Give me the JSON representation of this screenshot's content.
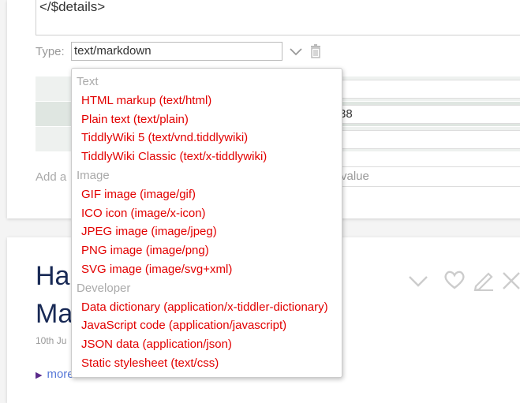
{
  "editor": {
    "text": "</$details>"
  },
  "type_field": {
    "label": "Type:",
    "value": "text/markdown"
  },
  "fields": {
    "row2_value_fragment": "38",
    "add_label": "Add a",
    "value_placeholder": "value"
  },
  "next_tiddler": {
    "title_line1": "Ha",
    "title_line2": "Ma",
    "date_fragment": "10th Ju",
    "more_label": "more"
  },
  "dropdown": {
    "groups": [
      {
        "label": "Text",
        "options": [
          "HTML markup (text/html)",
          "Plain text (text/plain)",
          "TiddlyWiki 5 (text/vnd.tiddlywiki)",
          "TiddlyWiki Classic (text/x-tiddlywiki)"
        ]
      },
      {
        "label": "Image",
        "options": [
          "GIF image (image/gif)",
          "ICO icon (image/x-icon)",
          "JPEG image (image/jpeg)",
          "PNG image (image/png)",
          "SVG image (image/svg+xml)"
        ]
      },
      {
        "label": "Developer",
        "options": [
          "Data dictionary (application/x-tiddler-dictionary)",
          "JavaScript code (application/javascript)",
          "JSON data (application/json)",
          "Static stylesheet (text/css)"
        ]
      }
    ]
  },
  "colors": {
    "option_text": "#e20000",
    "group_label": "#aaaaaa",
    "title": "#182955"
  }
}
